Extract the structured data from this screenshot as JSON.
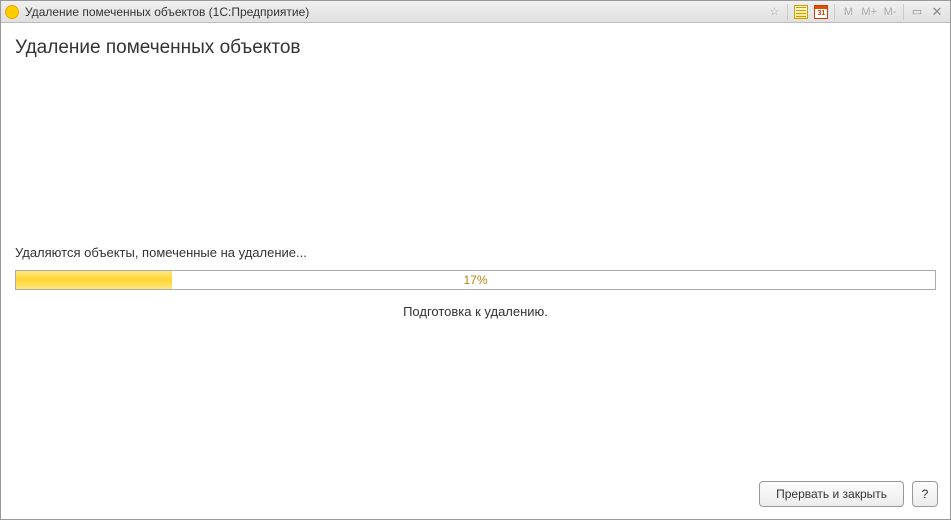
{
  "titlebar": {
    "icon_label": "1C",
    "title": "Удаление помеченных объектов  (1С:Предприятие)",
    "calendar_day": "31",
    "m_labels": {
      "m": "M",
      "mplus": "M+",
      "mminus": "M-"
    }
  },
  "page": {
    "title": "Удаление помеченных объектов"
  },
  "progress": {
    "status": "Удаляются объекты, помеченные на удаление...",
    "percent": 17,
    "percent_label": "17%",
    "stage": "Подготовка к удалению."
  },
  "footer": {
    "cancel_label": "Прервать и закрыть",
    "help_label": "?"
  }
}
